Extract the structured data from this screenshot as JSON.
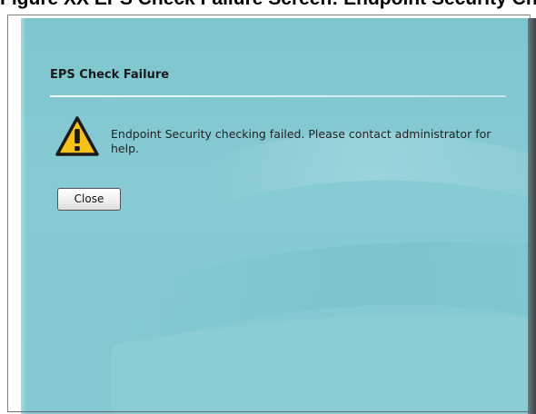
{
  "caption": {
    "text": "Figure XX EPS Check Failure Screen: Endpoint Security Check Failed"
  },
  "dialog": {
    "title": "EPS Check Failure",
    "message": "Endpoint Security checking failed. Please contact administrator for help.",
    "close_label": "Close",
    "icon": "warning-icon"
  },
  "colors": {
    "panel": "#84c9d2",
    "button_border": "#555555",
    "icon_fill": "#f6c21a"
  }
}
